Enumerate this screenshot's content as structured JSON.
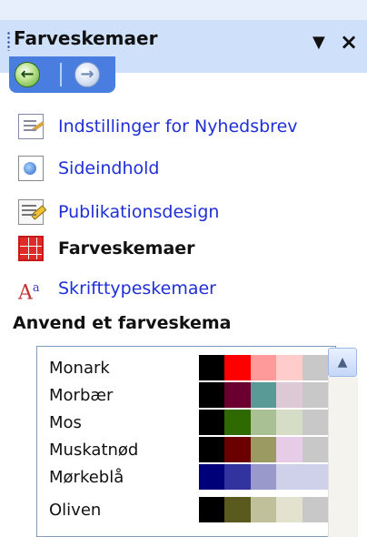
{
  "panel": {
    "title": "Farveskemaer",
    "dropdown_glyph": "▼",
    "close_glyph": "×"
  },
  "nav": {
    "back_icon": "back-arrow-icon",
    "forward_icon": "forward-arrow-icon",
    "back_glyph": "←",
    "forward_glyph": "→"
  },
  "tasks": [
    {
      "label": "Indstillinger for Nyhedsbrev",
      "icon": "newsletter-options-icon",
      "current": false
    },
    {
      "label": "Sideindhold",
      "icon": "page-content-icon",
      "current": false
    },
    {
      "label": "Publikationsdesign",
      "icon": "publication-design-icon",
      "current": false
    },
    {
      "label": "Farveskemaer",
      "icon": "color-schemes-icon",
      "current": true
    },
    {
      "label": "Skrifttypeskemaer",
      "icon": "font-schemes-icon",
      "current": false
    }
  ],
  "font_icon_glyph": "A",
  "font_icon_sup": "a",
  "section": {
    "title": "Anvend et farveskema"
  },
  "schemes": [
    {
      "name": "Monark",
      "colors": [
        "#000000",
        "#ff0000",
        "#ff9a9a",
        "#ffcccc",
        "#c8c8c8"
      ]
    },
    {
      "name": "Morbær",
      "colors": [
        "#000000",
        "#6b0030",
        "#5a9a96",
        "#ddc9d5",
        "#c8c8c8"
      ]
    },
    {
      "name": "Mos",
      "colors": [
        "#000000",
        "#2e6a00",
        "#a9c094",
        "#d6ddc7",
        "#c8c8c8"
      ]
    },
    {
      "name": "Muskatnød",
      "colors": [
        "#000000",
        "#6b0000",
        "#9a9a62",
        "#e6cce6",
        "#c8c8c8"
      ]
    },
    {
      "name": "Mørkeblå",
      "colors": [
        "#00007a",
        "#3333a0",
        "#9999cc",
        "#cfd0ea",
        "#cfd0ea"
      ]
    },
    {
      "name": "Oliven",
      "colors": [
        "#000000",
        "#5a5a1e",
        "#c0c09a",
        "#e2e2cf",
        "#c8c8c8"
      ]
    }
  ],
  "scroll": {
    "up_glyph": "▲"
  }
}
